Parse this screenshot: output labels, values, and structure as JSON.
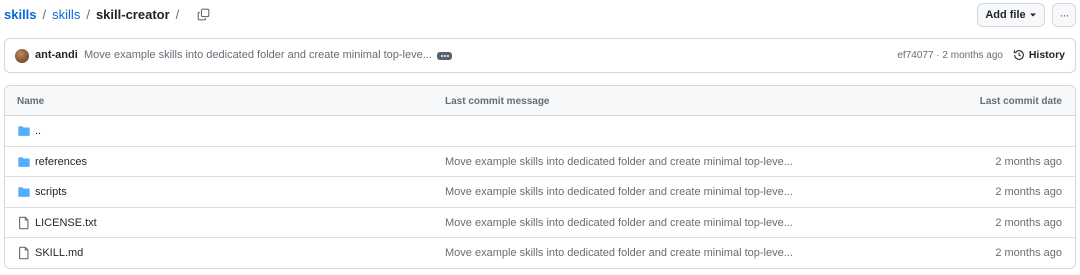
{
  "breadcrumb": {
    "repo": "skills",
    "folder": "skills",
    "current": "skill-creator",
    "separator": "/"
  },
  "toolbar": {
    "add_file_label": "Add file",
    "more_label": "···"
  },
  "latest_commit": {
    "author": "ant-andi",
    "message": "Move example skills into dedicated folder and create minimal top-leve...",
    "meta": "ef74077 · 2 months ago",
    "history_label": "History"
  },
  "table": {
    "headers": {
      "name": "Name",
      "message": "Last commit message",
      "date": "Last commit date"
    },
    "rows": [
      {
        "name": "..",
        "type": "folder",
        "message": "",
        "date": ""
      },
      {
        "name": "references",
        "type": "folder",
        "message": "Move example skills into dedicated folder and create minimal top-leve...",
        "date": "2 months ago"
      },
      {
        "name": "scripts",
        "type": "folder",
        "message": "Move example skills into dedicated folder and create minimal top-leve...",
        "date": "2 months ago"
      },
      {
        "name": "LICENSE.txt",
        "type": "file",
        "message": "Move example skills into dedicated folder and create minimal top-leve...",
        "date": "2 months ago"
      },
      {
        "name": "SKILL.md",
        "type": "file",
        "message": "Move example skills into dedicated folder and create minimal top-leve...",
        "date": "2 months ago"
      }
    ]
  },
  "colors": {
    "link": "#0969da",
    "folder": "#54aeff",
    "muted": "#656d76",
    "border": "#d0d7de"
  }
}
